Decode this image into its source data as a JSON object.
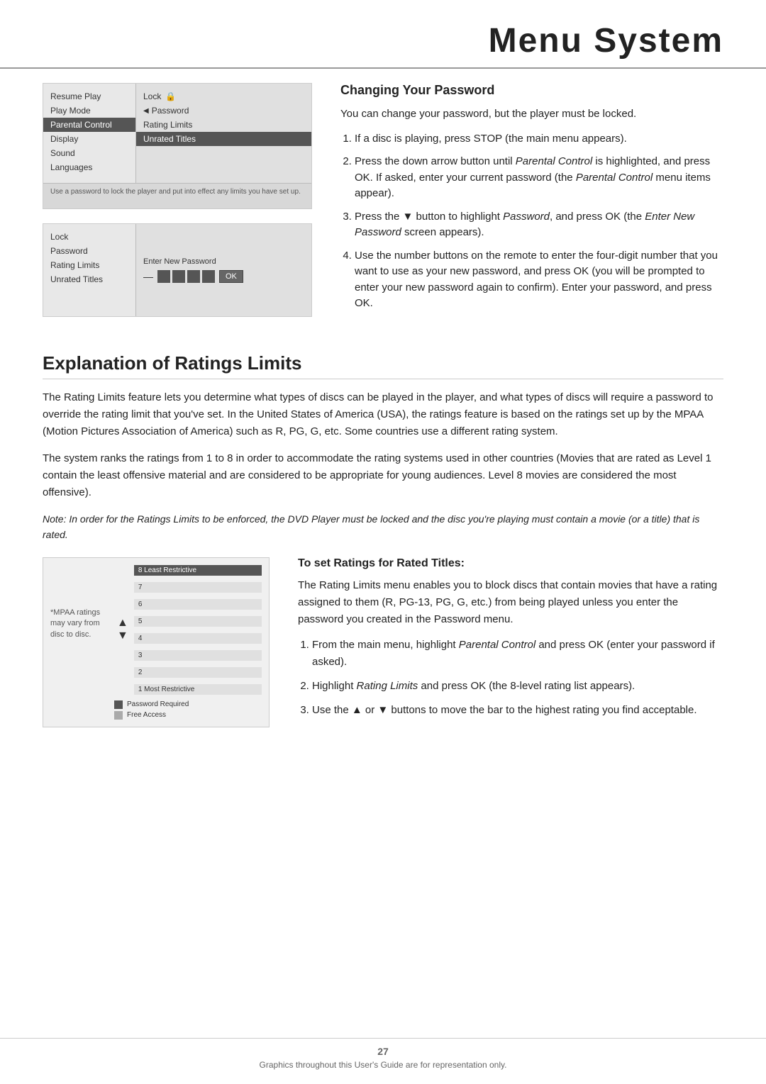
{
  "header": {
    "title": "Menu System"
  },
  "menu1": {
    "left_items": [
      {
        "label": "Resume Play",
        "selected": false
      },
      {
        "label": "Play Mode",
        "selected": false
      },
      {
        "label": "Parental Control",
        "selected": true
      },
      {
        "label": "Display",
        "selected": false
      },
      {
        "label": "Sound",
        "selected": false
      },
      {
        "label": "Languages",
        "selected": false
      }
    ],
    "right_items": [
      {
        "label": "Lock",
        "selected": false
      },
      {
        "label": "Password",
        "selected": false
      },
      {
        "label": "Rating Limits",
        "selected": false
      },
      {
        "label": "Unrated Titles",
        "selected": true
      }
    ],
    "footer": "Use a password to lock the player and put into effect any limits you have set up."
  },
  "menu2": {
    "left_items": [
      {
        "label": "Lock",
        "selected": false
      },
      {
        "label": "Password",
        "selected": false
      },
      {
        "label": "Rating Limits",
        "selected": false
      },
      {
        "label": "Unrated Titles",
        "selected": false
      }
    ],
    "password_label": "Enter New Password",
    "ok_label": "OK"
  },
  "changing_password": {
    "heading": "Changing Your Password",
    "intro": "You can change your password, but the player must be locked.",
    "steps": [
      "If a disc is playing, press STOP (the main menu appears).",
      "Press the down arrow button until Parental Control is highlighted, and press OK. If asked, enter your current password (the Parental Control menu items appear).",
      "Press the ▼ button to highlight Password, and press OK (the Enter New Password screen appears).",
      "Use the number buttons on the remote to enter the four-digit number that you want to use as your new password, and press OK (you will be prompted to enter your new password again to confirm). Enter your password, and press OK."
    ],
    "step2_italic1": "Parental Control",
    "step2_italic2": "Parental Control",
    "step3_italic": "Password",
    "step3_italic2": "Enter New Password"
  },
  "ratings_section": {
    "heading": "Explanation of Ratings Limits",
    "para1": "The Rating Limits feature lets you determine what types of discs can be played in the player, and what types of discs will require a password to override the rating limit that you've set. In the United States of America (USA), the ratings feature is based on the ratings set up by the MPAA (Motion Pictures Association of America) such as R, PG, G, etc. Some countries use a different rating system.",
    "para2": "The system ranks the ratings from 1 to 8 in order to accommodate the rating systems used in other countries (Movies that are rated as Level 1 contain the least offensive material and are considered to be appropriate for young audiences. Level 8 movies are considered the most offensive).",
    "note": "Note: In order for the Ratings Limits to be enforced, the DVD Player must be locked and the disc you're playing must contain a movie (or a title) that is rated.",
    "chart_note": "*MPAA ratings may vary from disc to disc.",
    "bars": [
      {
        "label": "8 Least Restrictive",
        "top": true
      },
      {
        "label": "7",
        "top": false
      },
      {
        "label": "6",
        "top": false
      },
      {
        "label": "5",
        "top": false
      },
      {
        "label": "4",
        "top": false
      },
      {
        "label": "3",
        "top": false
      },
      {
        "label": "2",
        "top": false
      },
      {
        "label": "1 Most Restrictive",
        "top": false
      }
    ],
    "legend_password": "Password Required",
    "legend_free": "Free Access",
    "rated_heading": "To set Ratings for Rated Titles:",
    "rated_intro": "The Rating Limits menu enables you to block discs that contain movies that have a rating assigned to them (R, PG-13, PG, G, etc.) from being played unless you enter the password you created in the Password menu.",
    "rated_steps": [
      "From the main menu, highlight Parental Control and press OK (enter your password if asked).",
      "Highlight Rating Limits and press OK (the 8-level rating list appears).",
      "Use the ▲ or ▼ buttons to move the bar to the highest rating you find acceptable."
    ],
    "step1_italic": "Parental Control",
    "step2_italic": "Rating Limits"
  },
  "footer": {
    "page_number": "27",
    "note": "Graphics throughout this User's Guide are for representation only."
  }
}
